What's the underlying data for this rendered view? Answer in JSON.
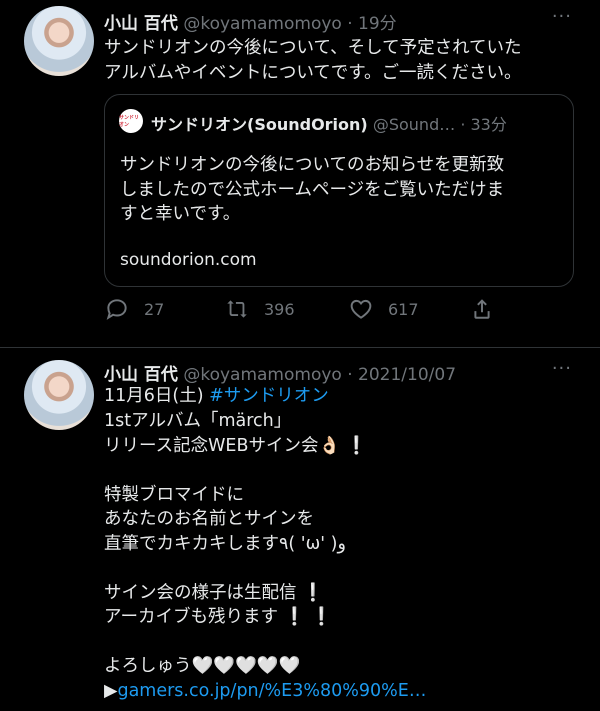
{
  "tweet1": {
    "name": "小山 百代",
    "handle": "@koyamamomoyo",
    "time": "· 19分",
    "text": "サンドリオンの今後について、そして予定されていた\nアルバムやイベントについてです。ご一読ください。",
    "quote": {
      "logo_text": "サンドリオン",
      "name": "サンドリオン(SoundOrion)",
      "handle": "@Sound…",
      "time": "· 33分",
      "text": "サンドリオンの今後についてのお知らせを更新致\nしましたので公式ホームページをご覧いただけま\nすと幸いです。",
      "link": "soundorion.com"
    },
    "replies": "27",
    "retweets": "396",
    "likes": "617"
  },
  "tweet2": {
    "name": "小山 百代",
    "handle": "@koyamamomoyo",
    "time": "· 2021/10/07",
    "line1_prefix": "11月6日(土) ",
    "hashtag": "#サンドリオン",
    "text": "1stアルバム「märch」\nリリース記念WEBサイン会👌🏻 ❕\n\n特製ブロマイドに\nあなたのお名前とサインを\n直筆でカキカキします٩( 'ω' )و\n\nサイン会の様子は生配信 ❕\nアーカイブも残ります ❕ ❕\n\nよろしゅう🤍🤍🤍🤍🤍",
    "link_prefix": "▶",
    "link": "gamers.co.jp/pn/%E3%80%90%E…"
  },
  "more_label": "···",
  "colors": {
    "background": "#000000",
    "text": "#e7e9ea",
    "muted": "#71767b",
    "accent": "#1d9bf0",
    "border": "#2f3336"
  }
}
